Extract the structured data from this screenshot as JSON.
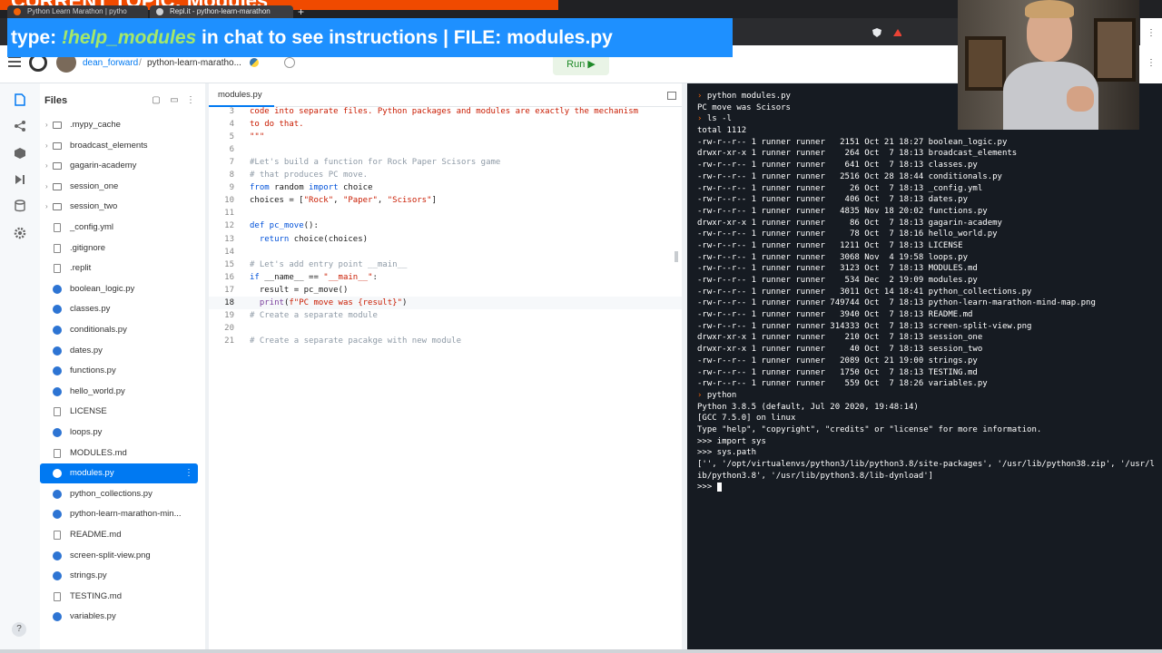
{
  "browser": {
    "tabs": [
      {
        "title": "Python Learn Marathon | pytho"
      },
      {
        "title": "Repl.it - python-learn-marathon"
      }
    ],
    "new_tab_symbol": "+"
  },
  "stream_banner": {
    "part1": "type: ",
    "command": "!help_modules",
    "part2": " in chat to see instructions | FILE: modules.py",
    "top_strip_text": "CURRENT TOPIC: Modules"
  },
  "header": {
    "owner": "dean_forward",
    "separator": "/",
    "repl_name": "python-learn-maratho...",
    "run_label": "Run ▶"
  },
  "files": {
    "title": "Files",
    "items": [
      {
        "name": ".mypy_cache",
        "type": "folder"
      },
      {
        "name": "broadcast_elements",
        "type": "folder"
      },
      {
        "name": "gagarin-academy",
        "type": "folder"
      },
      {
        "name": "session_one",
        "type": "folder"
      },
      {
        "name": "session_two",
        "type": "folder"
      },
      {
        "name": "_config.yml",
        "type": "file"
      },
      {
        "name": ".gitignore",
        "type": "file"
      },
      {
        "name": ".replit",
        "type": "file"
      },
      {
        "name": "boolean_logic.py",
        "type": "py"
      },
      {
        "name": "classes.py",
        "type": "py"
      },
      {
        "name": "conditionals.py",
        "type": "py"
      },
      {
        "name": "dates.py",
        "type": "py"
      },
      {
        "name": "functions.py",
        "type": "py"
      },
      {
        "name": "hello_world.py",
        "type": "py"
      },
      {
        "name": "LICENSE",
        "type": "file"
      },
      {
        "name": "loops.py",
        "type": "py"
      },
      {
        "name": "MODULES.md",
        "type": "file"
      },
      {
        "name": "modules.py",
        "type": "py",
        "active": true
      },
      {
        "name": "python_collections.py",
        "type": "py"
      },
      {
        "name": "python-learn-marathon-min...",
        "type": "py"
      },
      {
        "name": "README.md",
        "type": "file"
      },
      {
        "name": "screen-split-view.png",
        "type": "py"
      },
      {
        "name": "strings.py",
        "type": "py"
      },
      {
        "name": "TESTING.md",
        "type": "file"
      },
      {
        "name": "variables.py",
        "type": "py"
      }
    ]
  },
  "editor": {
    "tab_label": "modules.py",
    "current_line": 18,
    "lines": [
      {
        "n": "3",
        "parts": [
          {
            "t": "code into separate files. Python packages and modules are exactly the mechanism",
            "c": "c-red"
          }
        ]
      },
      {
        "n": "4",
        "parts": [
          {
            "t": "to do that.",
            "c": "c-red"
          }
        ]
      },
      {
        "n": "5",
        "parts": [
          {
            "t": "\"\"\"",
            "c": "c-red"
          }
        ]
      },
      {
        "n": "6",
        "parts": []
      },
      {
        "n": "7",
        "parts": [
          {
            "t": "#Let's build a function for Rock Paper Scisors game",
            "c": "c-com"
          }
        ]
      },
      {
        "n": "8",
        "parts": [
          {
            "t": "# that produces PC move.",
            "c": "c-com"
          }
        ]
      },
      {
        "n": "9",
        "parts": [
          {
            "t": "from",
            "c": "c-blue"
          },
          {
            "t": " random "
          },
          {
            "t": "import",
            "c": "c-blue"
          },
          {
            "t": " choice"
          }
        ]
      },
      {
        "n": "10",
        "parts": [
          {
            "t": "choices = ["
          },
          {
            "t": "\"Rock\"",
            "c": "c-red"
          },
          {
            "t": ", "
          },
          {
            "t": "\"Paper\"",
            "c": "c-red"
          },
          {
            "t": ", "
          },
          {
            "t": "\"Scisors\"",
            "c": "c-red"
          },
          {
            "t": "]"
          }
        ]
      },
      {
        "n": "11",
        "parts": []
      },
      {
        "n": "12",
        "parts": [
          {
            "t": "def",
            "c": "c-blue"
          },
          {
            "t": " pc_move",
            "c": "c-blue"
          },
          {
            "t": "():"
          }
        ]
      },
      {
        "n": "13",
        "parts": [
          {
            "t": "  "
          },
          {
            "t": "return",
            "c": "c-blue"
          },
          {
            "t": " choice(choices)"
          }
        ]
      },
      {
        "n": "14",
        "parts": []
      },
      {
        "n": "15",
        "parts": [
          {
            "t": "# Let's add entry point __main__",
            "c": "c-com"
          }
        ]
      },
      {
        "n": "16",
        "parts": [
          {
            "t": "if",
            "c": "c-blue"
          },
          {
            "t": " __name__ == "
          },
          {
            "t": "\"__main__\"",
            "c": "c-red"
          },
          {
            "t": ":"
          }
        ]
      },
      {
        "n": "17",
        "parts": [
          {
            "t": "  result = pc_move()"
          }
        ]
      },
      {
        "n": "18",
        "parts": [
          {
            "t": "  "
          },
          {
            "t": "print",
            "c": "c-purple"
          },
          {
            "t": "("
          },
          {
            "t": "f\"PC move was {result}\"",
            "c": "c-red"
          },
          {
            "t": ")"
          }
        ]
      },
      {
        "n": "19",
        "parts": [
          {
            "t": "# Create a separate module",
            "c": "c-com"
          }
        ]
      },
      {
        "n": "20",
        "parts": []
      },
      {
        "n": "21",
        "parts": [
          {
            "t": "# Create a separate pacakge with new module",
            "c": "c-com"
          }
        ]
      }
    ]
  },
  "console": {
    "lines": [
      {
        "prompt": true,
        "text": "python modules.py"
      },
      {
        "text": "PC move was Scisors"
      },
      {
        "prompt": true,
        "text": "ls -l"
      },
      {
        "text": "total 1112"
      },
      {
        "text": "-rw-r--r-- 1 runner runner   2151 Oct 21 18:27 boolean_logic.py"
      },
      {
        "text": "drwxr-xr-x 1 runner runner    264 Oct  7 18:13 broadcast_elements"
      },
      {
        "text": "-rw-r--r-- 1 runner runner    641 Oct  7 18:13 classes.py"
      },
      {
        "text": "-rw-r--r-- 1 runner runner   2516 Oct 28 18:44 conditionals.py"
      },
      {
        "text": "-rw-r--r-- 1 runner runner     26 Oct  7 18:13 _config.yml"
      },
      {
        "text": "-rw-r--r-- 1 runner runner    406 Oct  7 18:13 dates.py"
      },
      {
        "text": "-rw-r--r-- 1 runner runner   4835 Nov 18 20:02 functions.py"
      },
      {
        "text": "drwxr-xr-x 1 runner runner     86 Oct  7 18:13 gagarin-academy"
      },
      {
        "text": "-rw-r--r-- 1 runner runner     78 Oct  7 18:16 hello_world.py"
      },
      {
        "text": "-rw-r--r-- 1 runner runner   1211 Oct  7 18:13 LICENSE"
      },
      {
        "text": "-rw-r--r-- 1 runner runner   3068 Nov  4 19:58 loops.py"
      },
      {
        "text": "-rw-r--r-- 1 runner runner   3123 Oct  7 18:13 MODULES.md"
      },
      {
        "text": "-rw-r--r-- 1 runner runner    534 Dec  2 19:09 modules.py"
      },
      {
        "text": "-rw-r--r-- 1 runner runner   3011 Oct 14 18:41 python_collections.py"
      },
      {
        "text": "-rw-r--r-- 1 runner runner 749744 Oct  7 18:13 python-learn-marathon-mind-map.png"
      },
      {
        "text": "-rw-r--r-- 1 runner runner   3940 Oct  7 18:13 README.md"
      },
      {
        "text": "-rw-r--r-- 1 runner runner 314333 Oct  7 18:13 screen-split-view.png"
      },
      {
        "text": "drwxr-xr-x 1 runner runner    210 Oct  7 18:13 session_one"
      },
      {
        "text": "drwxr-xr-x 1 runner runner     40 Oct  7 18:13 session_two"
      },
      {
        "text": "-rw-r--r-- 1 runner runner   2089 Oct 21 19:00 strings.py"
      },
      {
        "text": "-rw-r--r-- 1 runner runner   1750 Oct  7 18:13 TESTING.md"
      },
      {
        "text": "-rw-r--r-- 1 runner runner    559 Oct  7 18:26 variables.py"
      },
      {
        "prompt": true,
        "text": "python"
      },
      {
        "text": "Python 3.8.5 (default, Jul 20 2020, 19:48:14)"
      },
      {
        "text": "[GCC 7.5.0] on linux"
      },
      {
        "text": "Type \"help\", \"copyright\", \"credits\" or \"license\" for more information."
      },
      {
        "text": ">>> import sys"
      },
      {
        "text": ">>> sys.path"
      },
      {
        "text": "['', '/opt/virtualenvs/python3/lib/python3.8/site-packages', '/usr/lib/python38.zip', '/usr/l"
      },
      {
        "text": "ib/python3.8', '/usr/lib/python3.8/lib-dynload']"
      },
      {
        "cursor": true,
        "text": ">>> "
      }
    ]
  },
  "help_symbol": "?",
  "colors": {
    "accent": "#0079f2",
    "banner": "#1e90ff",
    "banner_highlight": "#a4e86b",
    "console_bg": "#161b22",
    "run_green": "#1f8a28"
  }
}
